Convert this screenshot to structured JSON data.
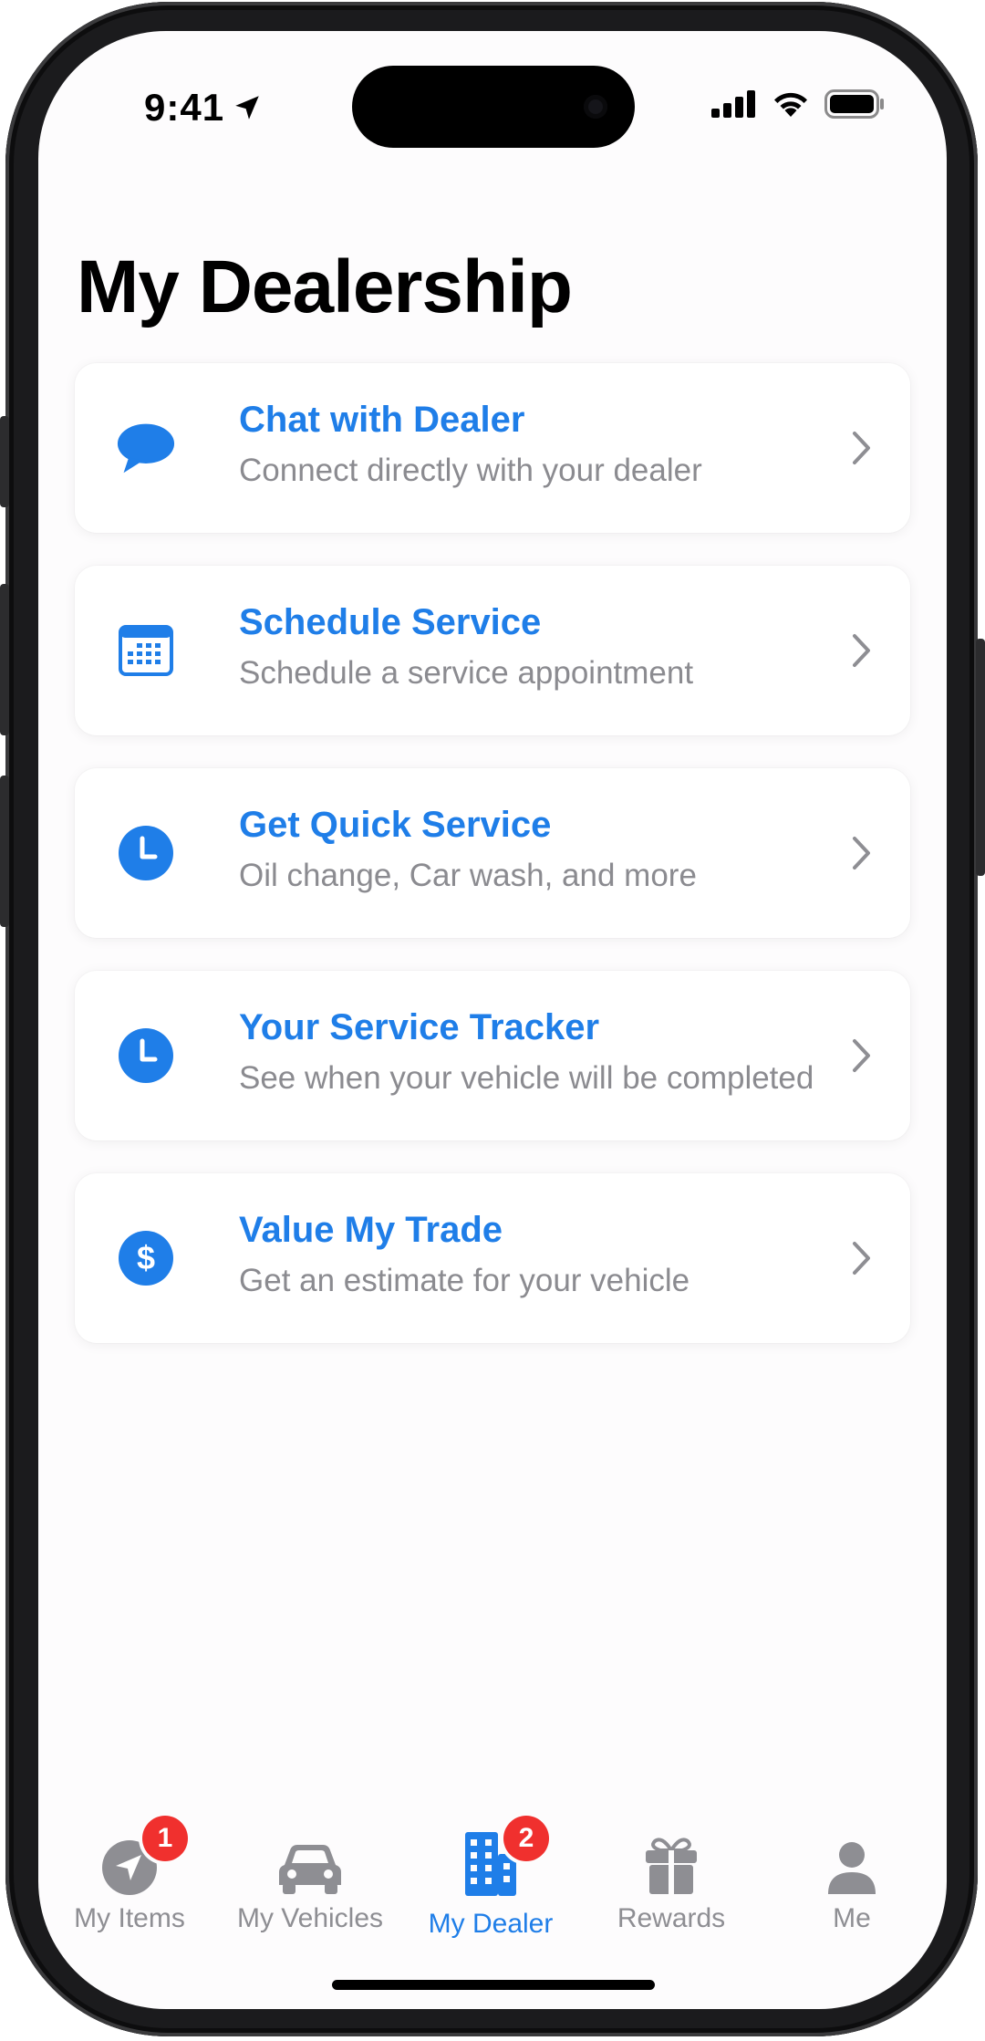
{
  "status": {
    "time": "9:41"
  },
  "page": {
    "title": "My Dealership"
  },
  "cards": [
    {
      "title": "Chat with Dealer",
      "subtitle": "Connect directly with your dealer",
      "icon": "chat-bubble-icon"
    },
    {
      "title": "Schedule Service",
      "subtitle": "Schedule a service appointment",
      "icon": "calendar-icon"
    },
    {
      "title": "Get Quick Service",
      "subtitle": "Oil change, Car wash, and more",
      "icon": "clock-icon"
    },
    {
      "title": "Your Service Tracker",
      "subtitle": "See when your vehicle will be completed",
      "icon": "clock-icon"
    },
    {
      "title": "Value My Trade",
      "subtitle": "Get an estimate for your vehicle",
      "icon": "dollar-icon"
    }
  ],
  "tabs": [
    {
      "label": "My Items",
      "badge": "1",
      "icon": "location-arrow-icon"
    },
    {
      "label": "My Vehicles",
      "icon": "car-icon"
    },
    {
      "label": "My Dealer",
      "badge": "2",
      "icon": "building-icon",
      "active": true
    },
    {
      "label": "Rewards",
      "icon": "gift-icon"
    },
    {
      "label": "Me",
      "icon": "person-icon"
    }
  ],
  "colors": {
    "accent": "#1f7ee8",
    "badge": "#f0302e",
    "secondary_text": "#8b8b90",
    "tab_inactive": "#8e8e93"
  }
}
